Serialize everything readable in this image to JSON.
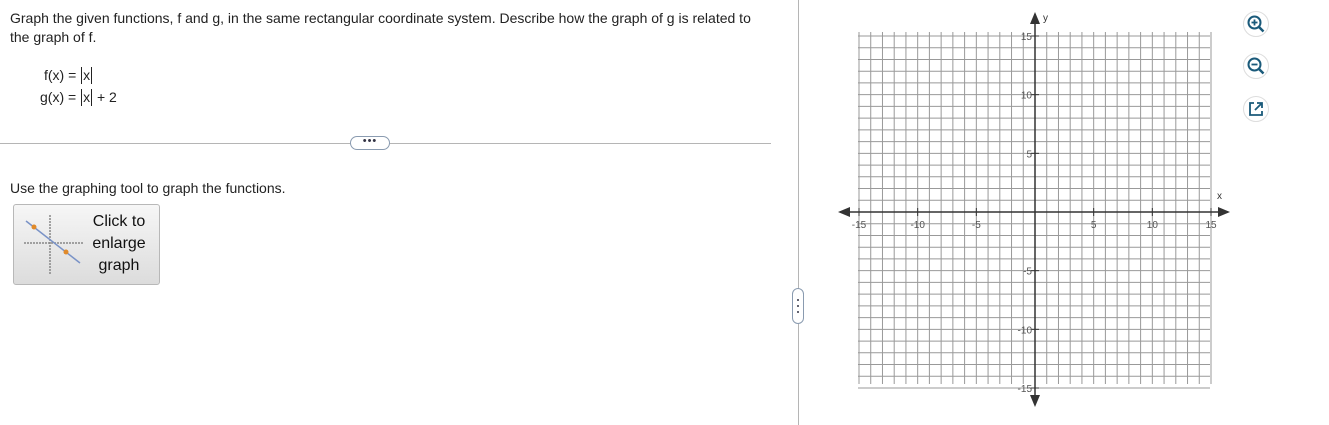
{
  "question": {
    "text": "Graph the given functions, f and g, in the same rectangular coordinate system. Describe how the graph of g is related to the graph of f.",
    "f_lhs": "f(x) = ",
    "f_arg": "x",
    "g_lhs": "g(x) = ",
    "g_arg": "x",
    "g_rhs": " + 2"
  },
  "divider": {
    "more_label": "•••"
  },
  "instructions": "Use the graphing tool to graph the functions.",
  "enlarge_button": {
    "label": "Click to enlarge graph"
  },
  "graph": {
    "x_axis_label": "x",
    "y_axis_label": "y",
    "x_min": -15,
    "x_max": 15,
    "y_min": -15,
    "y_max": 15,
    "grid": true,
    "tick_step": 5,
    "x_ticks": [
      "-15",
      "-10",
      "-5",
      "5",
      "10",
      "15"
    ],
    "y_ticks": [
      "15",
      "10",
      "5",
      "-5",
      "-10",
      "-15"
    ]
  },
  "tools": {
    "zoom_in": "zoom-in-icon",
    "zoom_out": "zoom-out-icon",
    "popout": "external-link-icon"
  },
  "colors": {
    "accent": "#1a5a7a",
    "grid": "#999999",
    "axis": "#333333"
  }
}
